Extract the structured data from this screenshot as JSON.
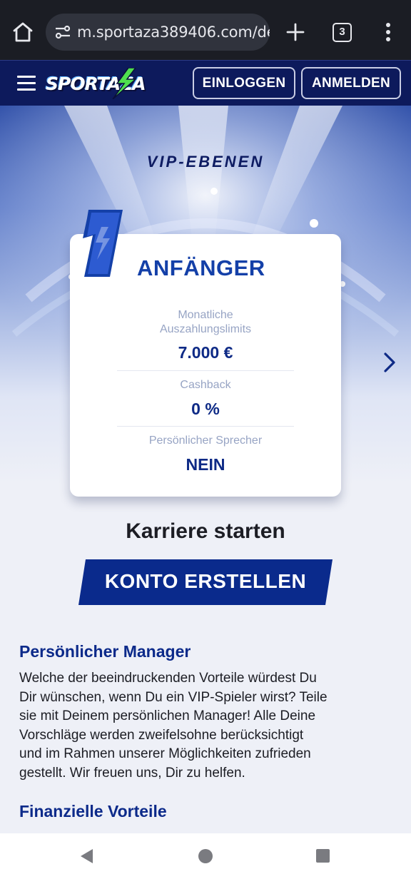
{
  "browser": {
    "url": "m.sportaza389406.com/de",
    "tab_count": "3"
  },
  "header": {
    "logo_text": "SPORTAZA",
    "login_label": "EINLOGGEN",
    "register_label": "ANMELDEN"
  },
  "vip": {
    "section_title": "VIP-EBENEN",
    "level_number": "1",
    "level_name": "ANFÄNGER",
    "stats": [
      {
        "label_line1": "Monatliche",
        "label_line2": "Auszahlungslimits",
        "value": "7.000 €"
      },
      {
        "label": "Cashback",
        "value": "0 %"
      },
      {
        "label": "Persönlicher Sprecher",
        "value": "NEIN"
      }
    ]
  },
  "cta": {
    "heading": "Karriere starten",
    "button_label": "KONTO ERSTELLEN"
  },
  "content": {
    "section1_title": "Persönlicher Manager",
    "section1_lines": [
      "Welche der beeindruckenden Vorteile würdest Du",
      "Dir wünschen, wenn Du ein VIP-Spieler wirst? Teile",
      "sie mit Deinem persönlichen Manager! Alle Deine",
      "Vorschläge werden zweifelsohne berücksichtigt",
      "und im Rahmen unserer Möglichkeiten zufrieden",
      "gestellt. Wir freuen uns, Dir zu helfen."
    ],
    "section2_title": "Finanzielle Vorteile"
  },
  "colors": {
    "header_bg": "#0d1a5c",
    "accent_blue": "#1440a8",
    "value_blue": "#0e2a86",
    "cta_bg": "#0a2a8c",
    "logo_green": "#4fe04f"
  },
  "icons": {
    "home": "home-icon",
    "site_settings": "site-settings-icon",
    "new_tab": "plus-icon",
    "overflow": "more-vert-icon",
    "menu": "hamburger-icon",
    "next": "chevron-right-icon"
  }
}
